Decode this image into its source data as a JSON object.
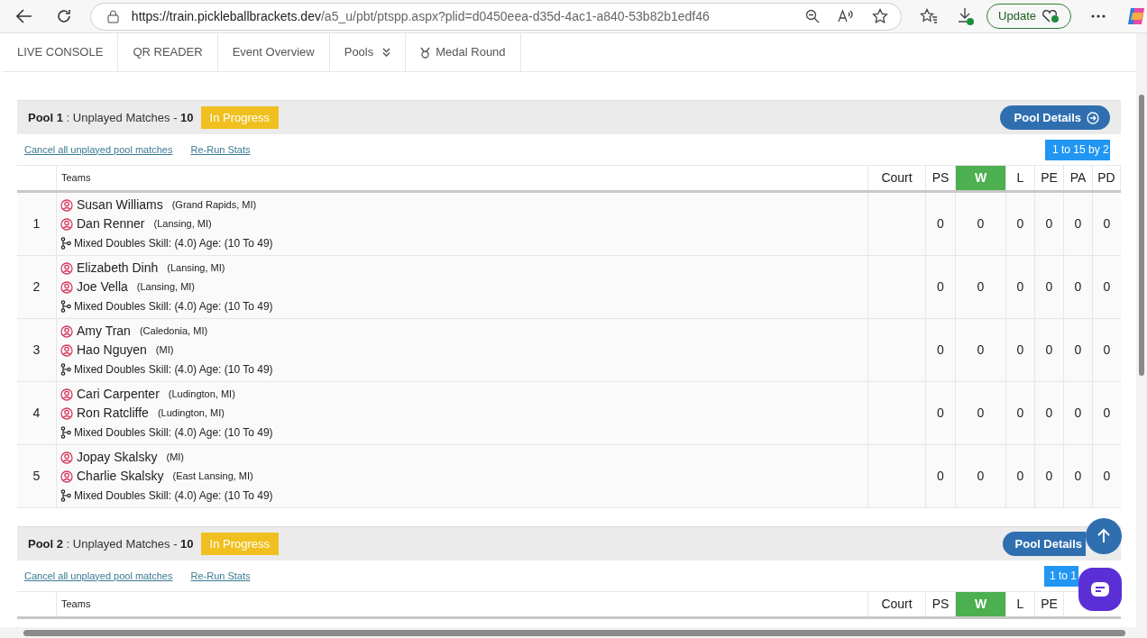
{
  "browser": {
    "url_host": "https://train.pickleballbrackets.dev",
    "url_path": "/a5_u/pbt/ptspp.aspx?plid=d0450eea-d35d-4ac1-a840-53b82b1edf46",
    "update_button": "Update"
  },
  "nav_tabs": [
    {
      "label": "LIVE CONSOLE",
      "kind": "text"
    },
    {
      "label": "QR READER",
      "kind": "text"
    },
    {
      "label": "Event Overview",
      "kind": "text"
    },
    {
      "label": "Pools",
      "kind": "dropdown"
    },
    {
      "label": "Medal Round",
      "kind": "medal"
    }
  ],
  "pools": [
    {
      "name": "Pool 1",
      "covered": false,
      "separator": " : ",
      "unplayed_label": "Unplayed Matches - ",
      "unplayed_count": "10",
      "status": "In Progress",
      "details_button": "Pool Details",
      "links": [
        "Cancel all unplayed pool matches",
        "Re-Run Stats"
      ],
      "range_button": "1 to 15 by 2",
      "columns": [
        {
          "label": "Teams",
          "highlight": false
        },
        {
          "label": "Court",
          "highlight": false
        },
        {
          "label": "PS",
          "highlight": false
        },
        {
          "label": "W",
          "highlight": true
        },
        {
          "label": "L",
          "highlight": false
        },
        {
          "label": "PE",
          "highlight": false
        },
        {
          "label": "PA",
          "highlight": false
        },
        {
          "label": "PD",
          "highlight": false
        }
      ],
      "rows": [
        {
          "index": "1",
          "players": [
            {
              "name": "Susan Williams",
              "location": "(Grand Rapids, MI)"
            },
            {
              "name": "Dan Renner",
              "location": "(Lansing, MI)"
            }
          ],
          "division": "Mixed Doubles Skill: (4.0) Age: (10 To 49)",
          "stats": [
            "0",
            "0",
            "0",
            "0",
            "0",
            "0"
          ]
        },
        {
          "index": "2",
          "players": [
            {
              "name": "Elizabeth Dinh",
              "location": "(Lansing, MI)"
            },
            {
              "name": "Joe Vella",
              "location": "(Lansing, MI)"
            }
          ],
          "division": "Mixed Doubles Skill: (4.0) Age: (10 To 49)",
          "stats": [
            "0",
            "0",
            "0",
            "0",
            "0",
            "0"
          ]
        },
        {
          "index": "3",
          "players": [
            {
              "name": "Amy Tran",
              "location": "(Caledonia, MI)"
            },
            {
              "name": "Hao Nguyen",
              "location": "(MI)"
            }
          ],
          "division": "Mixed Doubles Skill: (4.0) Age: (10 To 49)",
          "stats": [
            "0",
            "0",
            "0",
            "0",
            "0",
            "0"
          ]
        },
        {
          "index": "4",
          "players": [
            {
              "name": "Cari Carpenter",
              "location": "(Ludington, MI)"
            },
            {
              "name": "Ron Ratcliffe",
              "location": "(Ludington, MI)"
            }
          ],
          "division": "Mixed Doubles Skill: (4.0) Age: (10 To 49)",
          "stats": [
            "0",
            "0",
            "0",
            "0",
            "0",
            "0"
          ]
        },
        {
          "index": "5",
          "players": [
            {
              "name": "Jopay Skalsky",
              "location": "(MI)"
            },
            {
              "name": "Charlie Skalsky",
              "location": "(East Lansing, MI)"
            }
          ],
          "division": "Mixed Doubles Skill: (4.0) Age: (10 To 49)",
          "stats": [
            "0",
            "0",
            "0",
            "0",
            "0",
            "0"
          ]
        }
      ]
    },
    {
      "name": "Pool 2",
      "covered": true,
      "separator": " : ",
      "unplayed_label": "Unplayed Matches - ",
      "unplayed_count": "10",
      "status": "In Progress",
      "details_button": "Pool Details",
      "links": [
        "Cancel all unplayed pool matches",
        "Re-Run Stats"
      ],
      "range_button": "1 to 1",
      "columns": [
        {
          "label": "Teams",
          "highlight": false
        },
        {
          "label": "Court",
          "highlight": false
        },
        {
          "label": "PS",
          "highlight": false
        },
        {
          "label": "W",
          "highlight": true
        },
        {
          "label": "L",
          "highlight": false
        },
        {
          "label": "PE",
          "highlight": false
        }
      ]
    }
  ]
}
